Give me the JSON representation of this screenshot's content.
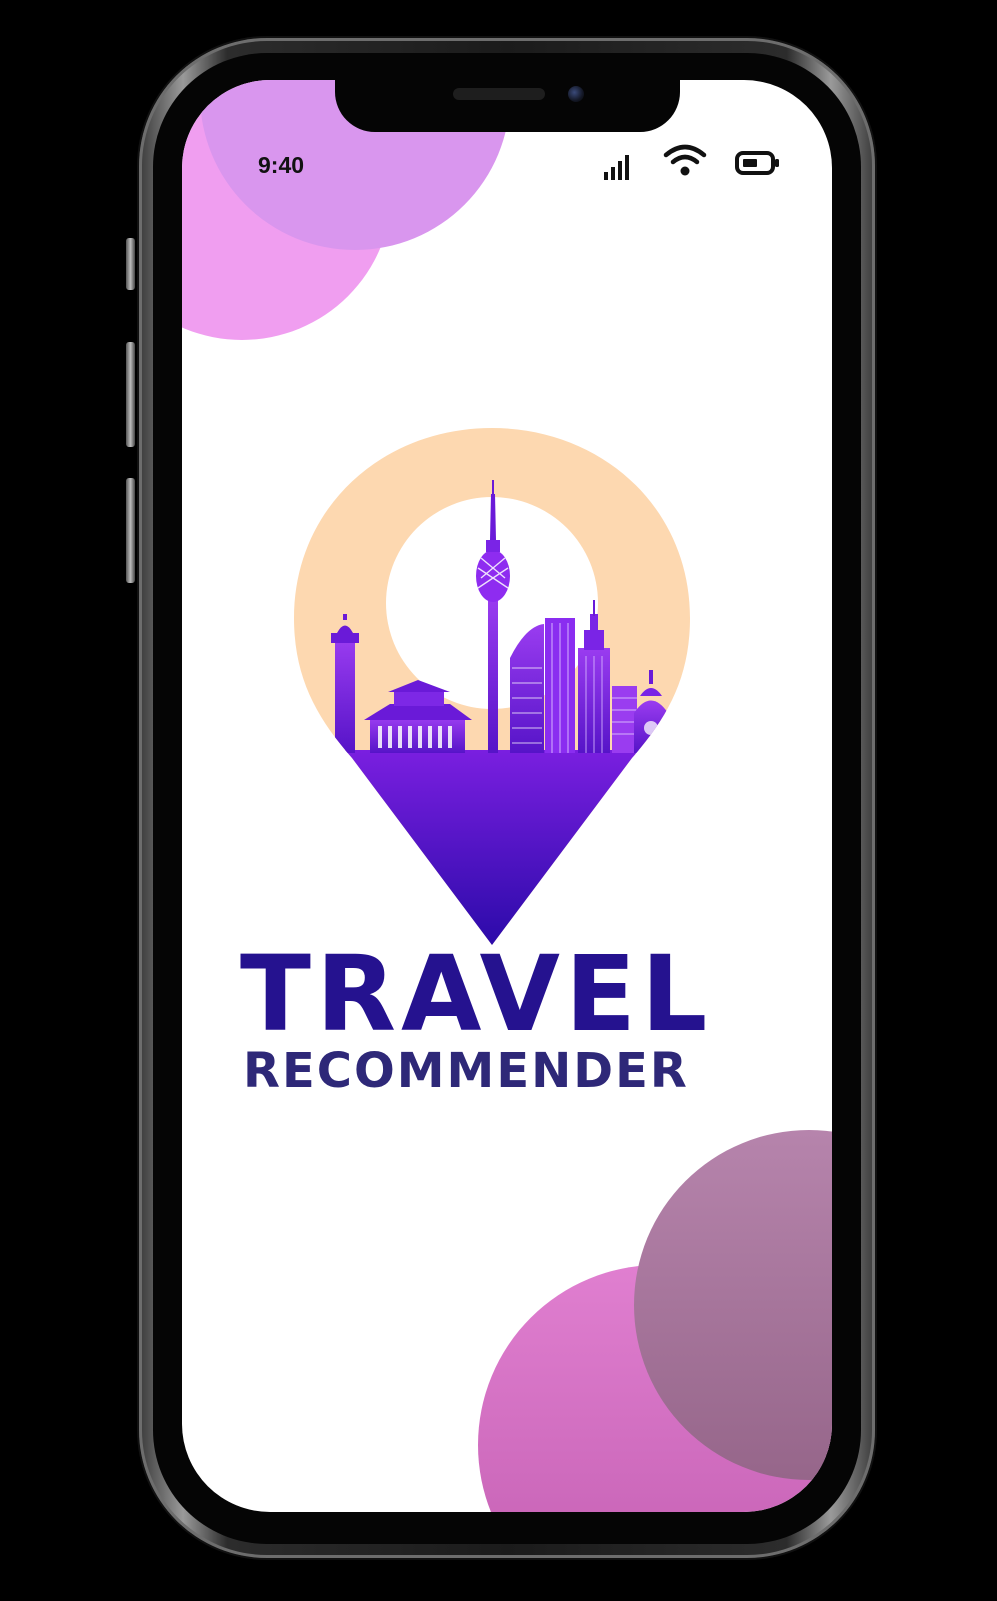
{
  "status_bar": {
    "time": "9:40",
    "icons": [
      "signal-bars-icon",
      "wifi-icon",
      "battery-icon"
    ]
  },
  "brand": {
    "title": "TRAVEL",
    "subtitle": "RECOMMENDER",
    "logo_icon": "map-pin-skyline-icon"
  },
  "colors": {
    "brand_dark": "#25128f",
    "brand_purple": "#5a18c7",
    "pin_peach": "#fdd8b0",
    "blob_lavender": "#dd98ec",
    "blob_pink": "#f09ef0",
    "blob_mauve": "#b07fa5",
    "blob_magenta": "#d870c0"
  }
}
